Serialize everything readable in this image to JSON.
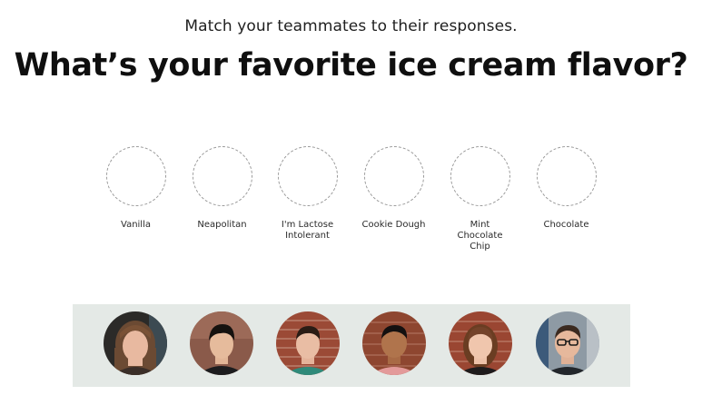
{
  "header": {
    "subtitle": "Match your teammates to their responses.",
    "question": "What’s your favorite ice cream flavor?"
  },
  "answers": [
    {
      "label": "Vanilla"
    },
    {
      "label": "Neapolitan"
    },
    {
      "label": "I'm Lactose Intolerant"
    },
    {
      "label": "Cookie Dough"
    },
    {
      "label": "Mint Chocolate Chip"
    },
    {
      "label": "Chocolate"
    }
  ],
  "colors": {
    "tray_background": "#e4e9e6",
    "slot_border": "#9a9a9a"
  },
  "teammates": [
    {
      "avatar": "teammate-photo-woman-brown-hair"
    },
    {
      "avatar": "teammate-photo-man-black-hair"
    },
    {
      "avatar": "teammate-photo-man-brick-wall"
    },
    {
      "avatar": "teammate-photo-man-pink-shirt"
    },
    {
      "avatar": "teammate-photo-woman-brick-wall"
    },
    {
      "avatar": "teammate-photo-man-glasses"
    }
  ]
}
